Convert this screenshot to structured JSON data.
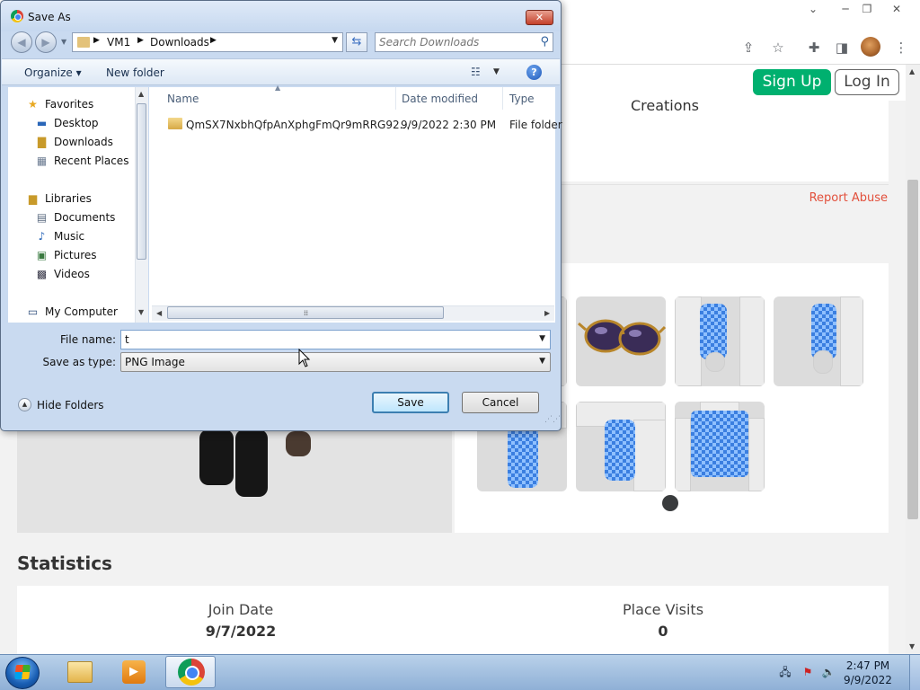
{
  "website": {
    "signup_label": "Sign Up",
    "login_label": "Log In",
    "creations_tab": "Creations",
    "report_abuse": "Report Abuse",
    "statistics_title": "Statistics",
    "stats": [
      {
        "label": "Join Date",
        "value": "9/7/2022"
      },
      {
        "label": "Place Visits",
        "value": "0"
      }
    ]
  },
  "dialog": {
    "title": "Save As",
    "close_glyph": "✕",
    "breadcrumb": [
      "VM1",
      "Downloads"
    ],
    "search_placeholder": "Search Downloads",
    "toolbar": {
      "organize": "Organize ▾",
      "new_folder": "New folder"
    },
    "nav": {
      "favorites": "Favorites",
      "desktop": "Desktop",
      "downloads": "Downloads",
      "recent_places": "Recent Places",
      "libraries": "Libraries",
      "documents": "Documents",
      "music": "Music",
      "pictures": "Pictures",
      "videos": "Videos",
      "my_computer": "My Computer"
    },
    "columns": {
      "name": "Name",
      "date_modified": "Date modified",
      "type": "Type"
    },
    "files": [
      {
        "name": "QmSX7NxbhQfpAnXphgFmQr9mRRG92...",
        "date_modified": "9/9/2022 2:30 PM",
        "type": "File folder"
      }
    ],
    "file_name_label": "File name:",
    "file_name_value": "t",
    "save_as_type_label": "Save as type:",
    "save_as_type_value": "PNG Image",
    "hide_folders": "Hide Folders",
    "save_button": "Save",
    "cancel_button": "Cancel"
  },
  "taskbar": {
    "time": "2:47 PM",
    "date": "9/9/2022"
  },
  "colors": {
    "roblox_green": "#00b06f",
    "report_red": "#e2503c",
    "checker_blue": "#3b7fe0"
  }
}
